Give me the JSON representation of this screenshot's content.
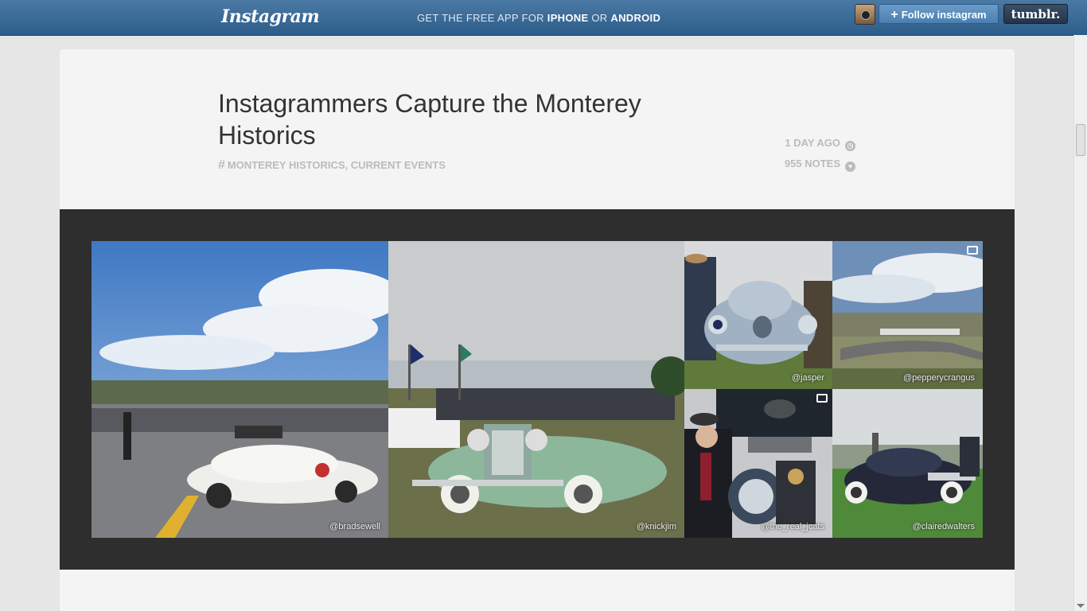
{
  "topbar": {
    "logo": "Instagram",
    "promo_prefix": "GET THE FREE APP FOR ",
    "promo_iphone": "IPHONE",
    "promo_or": " OR ",
    "promo_android": "ANDROID",
    "follow_label": "Follow instagram",
    "tumblr_label": "tumblr."
  },
  "post": {
    "title": "Instagrammers Capture the Monterey Historics",
    "tags": "MONTEREY HISTORICS, CURRENT EVENTS",
    "time": "1 DAY AGO",
    "notes": "955 NOTES"
  },
  "photos": [
    {
      "credit": "@bradsewell"
    },
    {
      "credit": "@knickjim"
    },
    {
      "credit": "@jasper"
    },
    {
      "credit": "@pepperycrangus"
    },
    {
      "credit": "@the_real_jcats"
    },
    {
      "credit": "@clairedwalters"
    }
  ],
  "colors": {
    "topbar": "#3a6a97",
    "follow_button": "#5b8fc0",
    "tumblr_button": "#2c3d52",
    "gallery_band": "#2e2e2e"
  }
}
